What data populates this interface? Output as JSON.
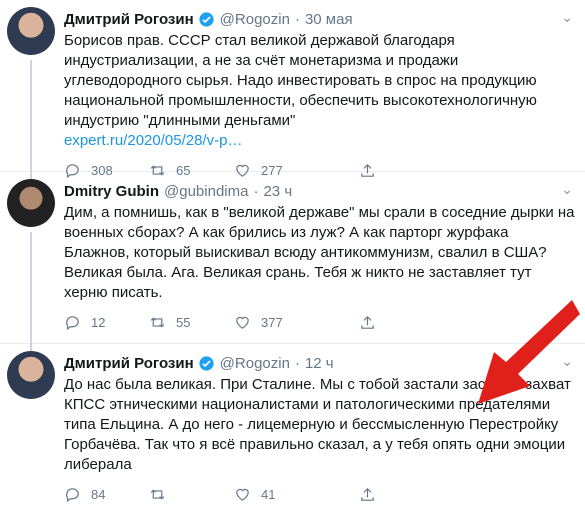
{
  "tweets": [
    {
      "name": "Дмитрий Рогозин",
      "verified": true,
      "handle": "@Rogozin",
      "time": "30 мая",
      "text": "Борисов прав. СССР стал великой державой благодаря индустриализации, а не за счёт монетаризма и продажи углеводородного сырья. Надо инвестировать в спрос на продукцию национальной промышленности, обеспечить высокотехнологичную индустрию \"длинными деньгами\"",
      "link": "expert.ru/2020/05/28/v-p…",
      "replies": "308",
      "retweets": "65",
      "likes": "277"
    },
    {
      "name": "Dmitry Gubin",
      "verified": false,
      "handle": "@gubindima",
      "time": "23 ч",
      "text": "Дим, а помнишь, как в \"великой державе\" мы срали в соседние дырки на военных сборах? А как брились из луж? А как парторг журфака Блажнов, который выискивал всюду антикоммунизм, свалил в США? Великая была. Ага. Великая срань. Тебя ж никто не заставляет тут херню писать.",
      "link": "",
      "replies": "12",
      "retweets": "55",
      "likes": "377"
    },
    {
      "name": "Дмитрий Рогозин",
      "verified": true,
      "handle": "@Rogozin",
      "time": "12 ч",
      "text": "До нас была великая. При Сталине. Мы с тобой застали застой и захват КПСС этническими националистами и патологическими предателями типа Ельцина. А до него - лицемерную и бессмысленную Перестройку Горбачёва. Так что я всё правильно сказал, а у тебя опять одни эмоции либерала",
      "link": "",
      "replies": "84",
      "retweets": "",
      "likes": "41"
    }
  ],
  "dot": "·",
  "colors": {
    "arrow": "#e0201b",
    "link": "#1b95e0",
    "verified": "#1da1f2"
  }
}
